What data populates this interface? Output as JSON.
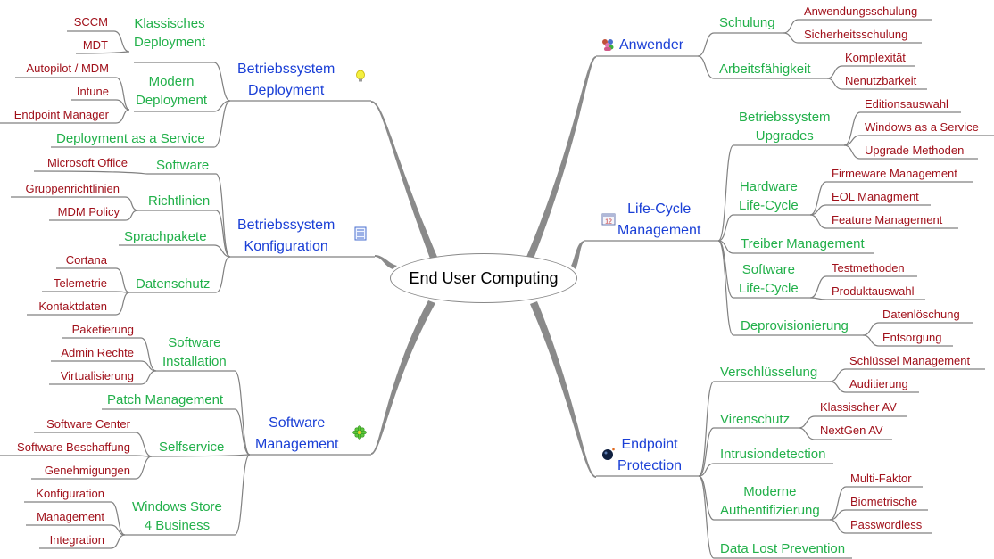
{
  "center": {
    "label": "End User Computing"
  },
  "colors": {
    "level1": "#1a3fd6",
    "level2": "#22b04a",
    "level3": "#a0101a",
    "line": "#808080"
  },
  "branches": {
    "os_deployment": {
      "label_line1": "Betriebssystem",
      "label_line2": "Deployment",
      "icon": "lightbulb-icon",
      "children": {
        "klassisch": {
          "line1": "Klassisches",
          "line2": "Deployment",
          "items": [
            "SCCM",
            "MDT"
          ]
        },
        "modern": {
          "line1": "Modern",
          "line2": "Deployment",
          "items": [
            "Autopilot / MDM",
            "Intune",
            "Endpoint Manager"
          ]
        },
        "daas": {
          "label": "Deployment as a Service"
        }
      }
    },
    "os_config": {
      "label_line1": "Betriebssystem",
      "label_line2": "Konfiguration",
      "icon": "list-icon",
      "children": {
        "software": {
          "label": "Software",
          "items": [
            "Microsoft Office"
          ]
        },
        "richtlinien": {
          "label": "Richtlinien",
          "items": [
            "Gruppenrichtlinien",
            "MDM Policy"
          ]
        },
        "sprachpakete": {
          "label": "Sprachpakete"
        },
        "datenschutz": {
          "label": "Datenschutz",
          "items": [
            "Cortana",
            "Telemetrie",
            "Kontaktdaten"
          ]
        }
      }
    },
    "software_mgmt": {
      "label_line1": "Software",
      "label_line2": "Management",
      "icon": "flower-icon",
      "children": {
        "installation": {
          "line1": "Software",
          "line2": "Installation",
          "items": [
            "Paketierung",
            "Admin Rechte",
            "Virtualisierung"
          ]
        },
        "patch": {
          "label": "Patch Management"
        },
        "selfservice": {
          "label": "Selfservice",
          "items": [
            "Software Center",
            "Software Beschaffung",
            "Genehmigungen"
          ]
        },
        "store": {
          "line1": "Windows Store",
          "line2": "4 Business",
          "items": [
            "Konfiguration",
            "Management",
            "Integration"
          ]
        }
      }
    },
    "anwender": {
      "label": "Anwender",
      "icon": "users-icon",
      "children": {
        "schulung": {
          "label": "Schulung",
          "items": [
            "Anwendungsschulung",
            "Sicherheitsschulung"
          ]
        },
        "arbeit": {
          "label": "Arbeitsfähigkeit",
          "items": [
            "Komplexität",
            "Nenutzbarkeit"
          ]
        }
      }
    },
    "lifecycle": {
      "label_line1": "Life-Cycle",
      "label_line2": "Management",
      "icon": "calendar-icon",
      "children": {
        "os_upgrades": {
          "line1": "Betriebssystem",
          "line2": "Upgrades",
          "items": [
            "Editionsauswahl",
            "Windows as a Service",
            "Upgrade Methoden"
          ]
        },
        "hw": {
          "line1": "Hardware",
          "line2": "Life-Cycle",
          "items": [
            "Firmeware Management",
            "EOL Managment",
            "Feature Management"
          ]
        },
        "treiber": {
          "label": "Treiber Management"
        },
        "sw": {
          "line1": "Software",
          "line2": "Life-Cycle",
          "items": [
            "Testmethoden",
            "Produktauswahl"
          ]
        },
        "deprov": {
          "label": "Deprovisionierung",
          "items": [
            "Datenlöschung",
            "Entsorgung"
          ]
        }
      }
    },
    "endpoint": {
      "label_line1": "Endpoint",
      "label_line2": "Protection",
      "icon": "bomb-icon",
      "children": {
        "verschl": {
          "label": "Verschlüsselung",
          "items": [
            "Schlüssel Management",
            "Auditierung"
          ]
        },
        "viren": {
          "label": "Virenschutz",
          "items": [
            "Klassischer AV",
            "NextGen AV"
          ]
        },
        "ids": {
          "label": "Intrusiondetection"
        },
        "auth": {
          "line1": "Moderne",
          "line2": "Authentifizierung",
          "items": [
            "Multi-Faktor",
            "Biometrische",
            "Passwordless"
          ]
        },
        "dlp": {
          "label": "Data Lost Prevention"
        }
      }
    }
  }
}
